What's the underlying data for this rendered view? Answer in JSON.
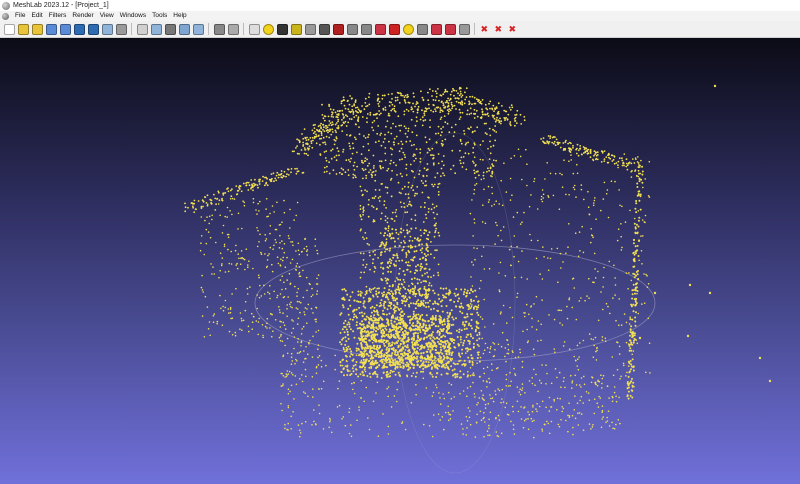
{
  "window": {
    "title": "MeshLab 2023.12 - [Project_1]"
  },
  "menu": {
    "items": [
      "File",
      "Edit",
      "Filters",
      "Render",
      "View",
      "Windows",
      "Tools",
      "Help"
    ]
  },
  "toolbar": {
    "buttons": [
      {
        "name": "new-project-icon",
        "group": 1,
        "color": "#ffffff"
      },
      {
        "name": "open-project-icon",
        "group": 1,
        "color": "#e8c43a"
      },
      {
        "name": "save-project-icon",
        "group": 1,
        "color": "#e8c43a"
      },
      {
        "name": "reload-icon",
        "group": 1,
        "color": "#5b8bd6"
      },
      {
        "name": "reload-all-icon",
        "group": 1,
        "color": "#5b8bd6"
      },
      {
        "name": "import-mesh-icon",
        "group": 1,
        "color": "#2d6bb3"
      },
      {
        "name": "export-mesh-icon",
        "group": 1,
        "color": "#2d6bb3"
      },
      {
        "name": "snapshot-icon",
        "group": 1,
        "color": "#8fb3d9"
      },
      {
        "name": "layer-icon",
        "group": 1,
        "color": "#9a9a9a"
      },
      {
        "name": "bbox-icon",
        "group": 2,
        "color": "#d0d0d0"
      },
      {
        "name": "points-render-icon",
        "group": 2,
        "color": "#8fb3d9"
      },
      {
        "name": "wireframe-icon",
        "group": 2,
        "color": "#777777"
      },
      {
        "name": "flat-render-icon",
        "group": 2,
        "color": "#7fa6d0"
      },
      {
        "name": "smooth-render-icon",
        "group": 2,
        "color": "#8fb3d9"
      },
      {
        "name": "light-icon",
        "group": 3,
        "color": "#888888"
      },
      {
        "name": "normal-lighting-icon",
        "group": 3,
        "color": "#aaaaaa"
      },
      {
        "name": "texture-icon",
        "group": 4,
        "color": "#dddddd"
      },
      {
        "name": "annotation-icon",
        "group": 4,
        "color": "#f2d21b"
      },
      {
        "name": "measure-icon",
        "group": 4,
        "color": "#333333"
      },
      {
        "name": "pick-points-icon",
        "group": 4,
        "color": "#c9b41c"
      },
      {
        "name": "align-icon",
        "group": 4,
        "color": "#999999"
      },
      {
        "name": "paint-icon",
        "group": 4,
        "color": "#555555"
      },
      {
        "name": "raster-icon",
        "group": 4,
        "color": "#b02020"
      },
      {
        "name": "select-vertices-icon",
        "group": 4,
        "color": "#888888"
      },
      {
        "name": "select-faces-icon",
        "group": 4,
        "color": "#888888"
      },
      {
        "name": "select-connected-icon",
        "group": 4,
        "color": "#cc3344"
      },
      {
        "name": "transform-icon",
        "group": 4,
        "color": "#cc2222"
      },
      {
        "name": "info-icon",
        "group": 4,
        "color": "#f2d21b"
      },
      {
        "name": "select-region-icon",
        "group": 4,
        "color": "#888888"
      },
      {
        "name": "manipulator-icon",
        "group": 4,
        "color": "#cc3344"
      },
      {
        "name": "fill-hole-icon",
        "group": 4,
        "color": "#cc3344"
      },
      {
        "name": "cut-icon",
        "group": 4,
        "color": "#999999"
      },
      {
        "name": "delete-vertices-icon",
        "group": 5,
        "color": "#d62222"
      },
      {
        "name": "delete-faces-icon",
        "group": 5,
        "color": "#d62222"
      },
      {
        "name": "delete-faces-vertices-icon",
        "group": 5,
        "color": "#d62222"
      }
    ]
  },
  "viewport": {
    "point_color": "#f2e052",
    "trackball_color": "#b9b9d6"
  }
}
